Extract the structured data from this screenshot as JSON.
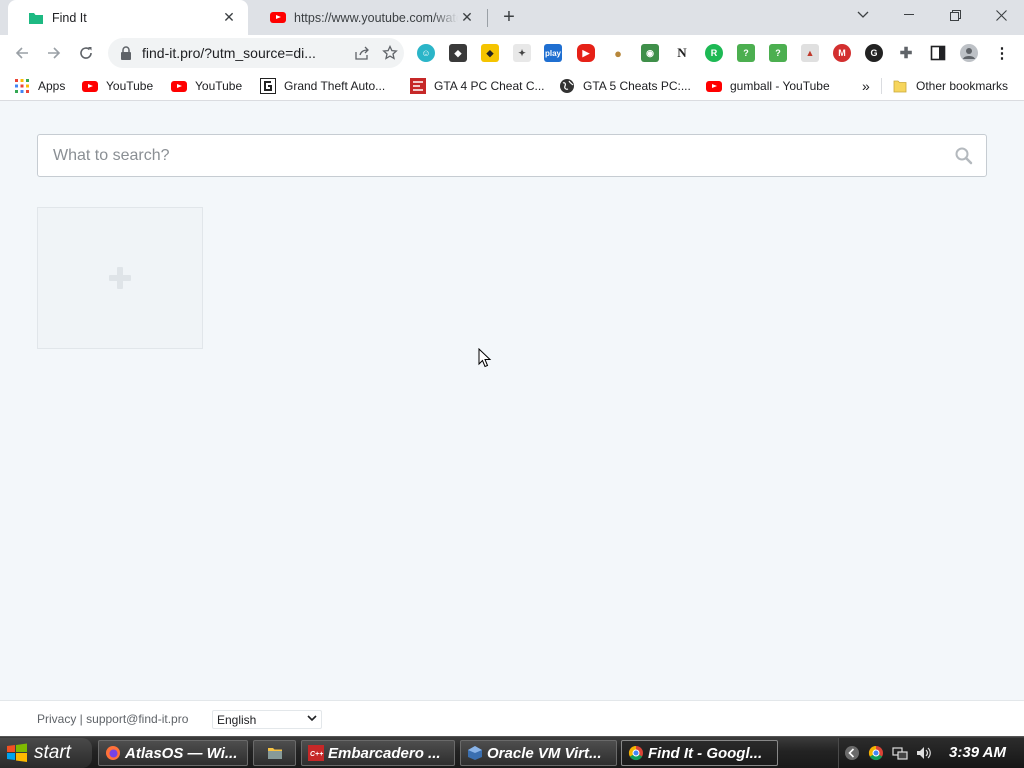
{
  "browser": {
    "tabs": [
      {
        "title": "Find It",
        "active": true
      },
      {
        "title": "https://www.youtube.com/watch",
        "active": false
      }
    ],
    "new_tab_label": "+",
    "url": "find-it.pro/?utm_source=di...",
    "extensions": [
      "ext-1",
      "ext-2",
      "ext-3",
      "ext-4",
      "ext-play",
      "ext-6",
      "ext-7",
      "ext-8",
      "ext-n",
      "ext-r",
      "ext-11",
      "ext-12",
      "ext-13",
      "ext-m",
      "ext-15"
    ],
    "bookmarks": [
      {
        "label": "Apps"
      },
      {
        "label": "YouTube"
      },
      {
        "label": "YouTube"
      },
      {
        "label": "Grand Theft Auto..."
      },
      {
        "label": "GTA 4 PC Cheat C..."
      },
      {
        "label": "GTA 5 Cheats PC:..."
      },
      {
        "label": "gumball - YouTube"
      }
    ],
    "bookmarks_overflow": "»",
    "other_bookmarks": "Other bookmarks"
  },
  "page": {
    "search_placeholder": "What to search?",
    "add_tile_icon": "plus-icon",
    "footer": {
      "privacy": "Privacy",
      "separator": " | ",
      "support": "support@find-it.pro",
      "language": "English"
    }
  },
  "taskbar": {
    "start_label": "start",
    "tasks": [
      {
        "label": "AtlasOS — Wi..."
      },
      {
        "label": ""
      },
      {
        "label": "Embarcadero ..."
      },
      {
        "label": "Oracle VM Virt..."
      },
      {
        "label": "Find It - Googl..."
      }
    ],
    "clock": "3:39 AM"
  },
  "colors": {
    "page_bg": "#f3f7fa",
    "tab_strip": "#dee1e6",
    "youtube_red": "#ff0000",
    "find_it_green": "#1db982"
  }
}
